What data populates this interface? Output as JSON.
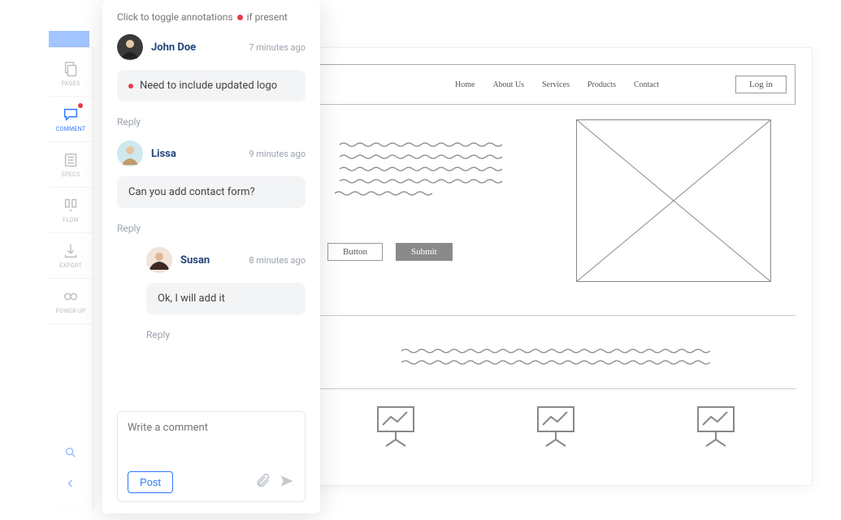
{
  "sidebar": {
    "items": [
      {
        "label": "PAGES"
      },
      {
        "label": "COMMENT"
      },
      {
        "label": "SPECS"
      },
      {
        "label": "FLOW"
      },
      {
        "label": "EXPORT"
      },
      {
        "label": "POWER-UP"
      }
    ]
  },
  "panel": {
    "hint_before": "Click to toggle annotations",
    "hint_after": "if present",
    "composer_placeholder": "Write a comment",
    "post_label": "Post",
    "reply_label": "Reply"
  },
  "comments": [
    {
      "author": "John Doe",
      "time": "7 minutes ago",
      "text": "Need to include updated logo",
      "has_annotation_dot": true
    },
    {
      "author": "Lissa",
      "time": "9 minutes ago",
      "text": "Can you add contact form?",
      "has_annotation_dot": false
    },
    {
      "author": "Susan",
      "time": "8 minutes ago",
      "text": "Ok, I will add it",
      "nested": true,
      "has_annotation_dot": false
    }
  ],
  "wireframe": {
    "nav": {
      "items": [
        "Home",
        "About Us",
        "Services",
        "Products",
        "Contact"
      ],
      "login": "Log in"
    },
    "buttons": {
      "primary": "Button",
      "secondary": "Submit"
    }
  }
}
